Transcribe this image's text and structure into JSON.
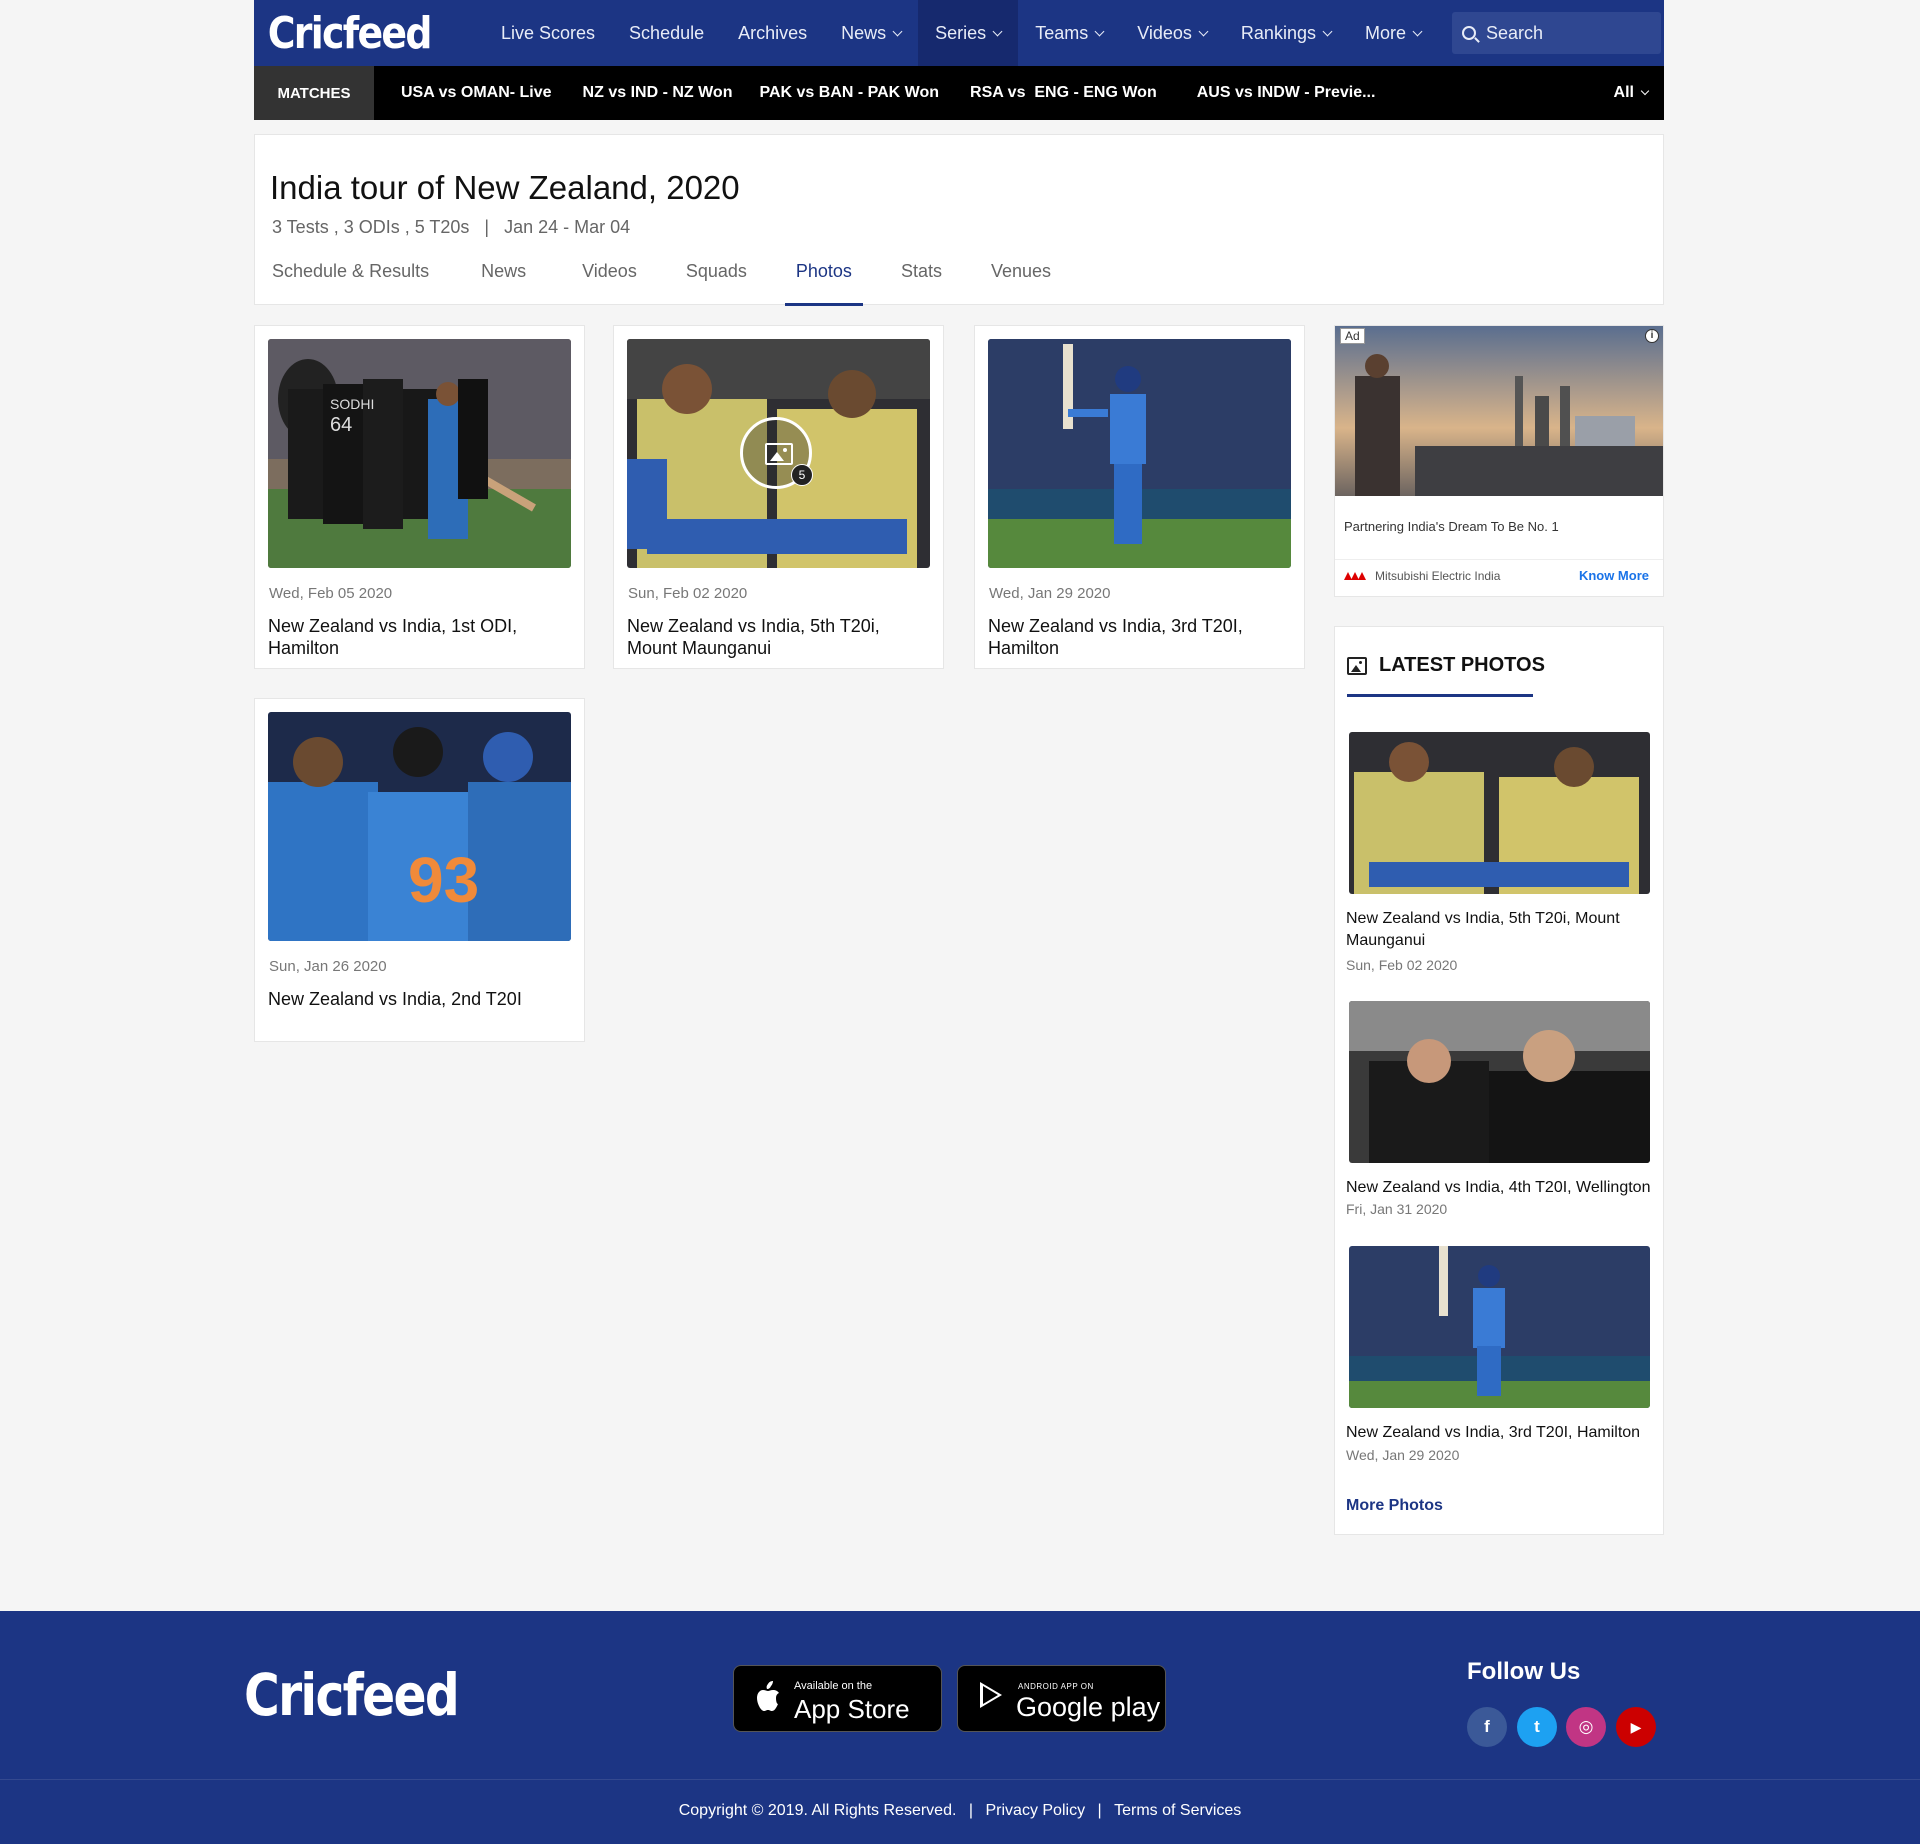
{
  "brand": {
    "logo": "Cricfeed"
  },
  "nav": {
    "items": [
      {
        "label": "Live Scores",
        "dropdown": false,
        "active": false
      },
      {
        "label": "Schedule",
        "dropdown": false,
        "active": false
      },
      {
        "label": "Archives",
        "dropdown": false,
        "active": false
      },
      {
        "label": "News",
        "dropdown": true,
        "active": false
      },
      {
        "label": "Series",
        "dropdown": true,
        "active": true
      },
      {
        "label": "Teams",
        "dropdown": true,
        "active": false
      },
      {
        "label": "Videos",
        "dropdown": true,
        "active": false
      },
      {
        "label": "Rankings",
        "dropdown": true,
        "active": false
      },
      {
        "label": "More",
        "dropdown": true,
        "active": false
      }
    ],
    "search_placeholder": "Search"
  },
  "matches_bar": {
    "label": "MATCHES",
    "items": [
      "USA vs OMAN- Live",
      "NZ vs IND - NZ Won",
      "PAK vs BAN - PAK Won",
      "RSA vs  ENG - ENG Won",
      "AUS vs INDW - Previe..."
    ],
    "filter": "All"
  },
  "series": {
    "title": "India tour of New Zealand, 2020",
    "meta": "3 Tests , 3 ODIs , 5 T20s   |   Jan 24 - Mar 04",
    "tabs": [
      "Schedule & Results",
      "News",
      "Videos",
      "Squads",
      "Photos",
      "Stats",
      "Venues"
    ],
    "active_tab": "Photos"
  },
  "galleries": [
    {
      "date": "Wed, Feb 05 2020",
      "title": "New Zealand vs India, 1st ODI, Hamilton"
    },
    {
      "date": "Sun, Feb 02 2020",
      "title": "New Zealand vs India, 5th T20i, Mount Maunganui",
      "photo_count": "5"
    },
    {
      "date": "Wed, Jan 29 2020",
      "title": "New Zealand vs India, 3rd T20I, Hamilton"
    },
    {
      "date": "Sun, Jan 26 2020",
      "title": "New Zealand vs India, 2nd T20I"
    }
  ],
  "ad": {
    "badge": "Ad",
    "info": "i",
    "text": "Partnering India's Dream To Be No. 1",
    "advertiser": "Mitsubishi Electric India",
    "cta": "Know More"
  },
  "latest_photos": {
    "heading": "LATEST PHOTOS",
    "items": [
      {
        "title": "New Zealand vs India, 5th T20i, Mount Maunganui",
        "date": "Sun, Feb 02 2020"
      },
      {
        "title": "New Zealand vs India, 4th T20I, Wellington",
        "date": "Fri, Jan 31 2020"
      },
      {
        "title": "New Zealand vs India, 3rd T20I, Hamilton",
        "date": "Wed, Jan 29 2020"
      }
    ],
    "more_label": "More Photos"
  },
  "footer": {
    "logo": "Cricfeed",
    "app_store": {
      "small": "Available on the",
      "big": "App Store"
    },
    "google_play": {
      "small": "ANDROID APP ON",
      "big": "Google play"
    },
    "follow_us": "Follow Us",
    "social": [
      {
        "icon": "facebook-icon",
        "glyph": "f",
        "color": "#3b5998"
      },
      {
        "icon": "twitter-icon",
        "glyph": "t",
        "color": "#1da1f2"
      },
      {
        "icon": "instagram-icon",
        "glyph": "◎",
        "color": "#c13584"
      },
      {
        "icon": "youtube-icon",
        "glyph": "▶",
        "color": "#cc0000"
      }
    ],
    "copyright": "Copyright © 2019. All Rights Reserved.",
    "links": [
      "Privacy Policy",
      "Terms of Services"
    ]
  },
  "colors": {
    "brand_blue": "#1c3584",
    "active_nav": "#16296e",
    "matches_bar": "#000000"
  }
}
